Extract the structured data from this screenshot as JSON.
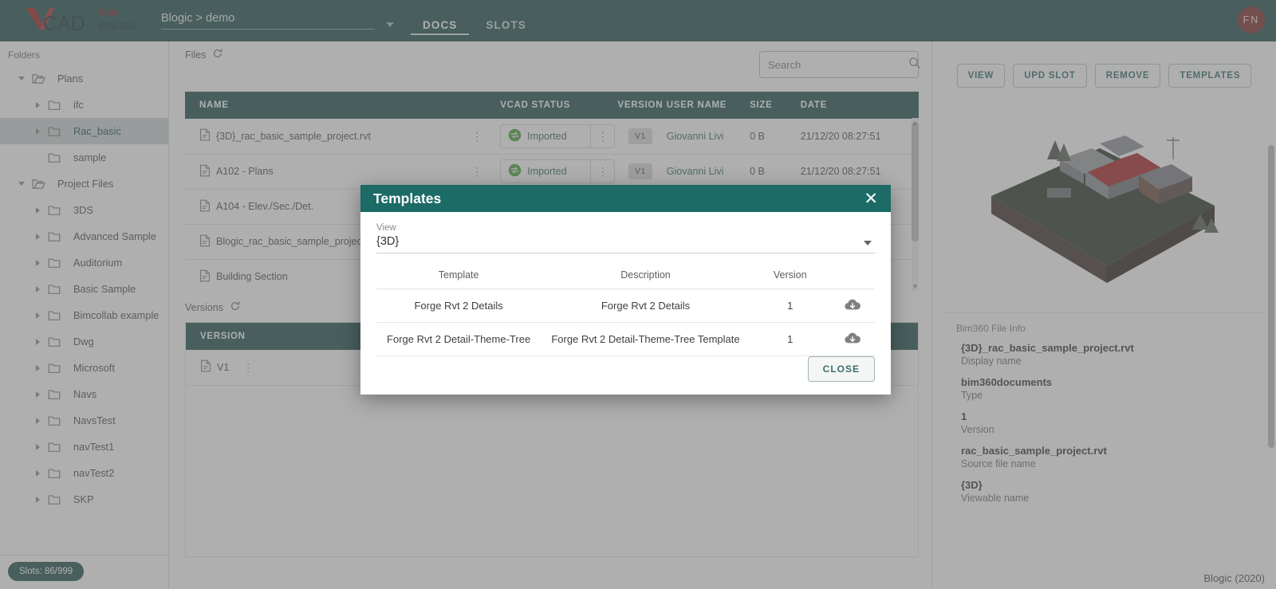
{
  "brand": {
    "logo_v": "V",
    "logo_cad": "CAD",
    "logo_for": "FOR",
    "logo_bim": "BIM360"
  },
  "topbar": {
    "project": "Blogic > demo",
    "tabs": [
      {
        "label": "DOCS",
        "active": true
      },
      {
        "label": "SLOTS",
        "active": false
      }
    ],
    "avatar_initials": "FN"
  },
  "sidebar": {
    "title": "Folders",
    "items": [
      {
        "label": "Plans",
        "level": 0,
        "expanded": true,
        "arrow": "down",
        "selected": false,
        "open_folder": true
      },
      {
        "label": "ifc",
        "level": 1,
        "expanded": false,
        "arrow": "right",
        "selected": false,
        "open_folder": false
      },
      {
        "label": "Rac_basic",
        "level": 1,
        "expanded": false,
        "arrow": "right",
        "selected": true,
        "open_folder": false
      },
      {
        "label": "sample",
        "level": 1,
        "expanded": false,
        "arrow": "none",
        "selected": false,
        "open_folder": false
      },
      {
        "label": "Project Files",
        "level": 0,
        "expanded": true,
        "arrow": "down",
        "selected": false,
        "open_folder": true
      },
      {
        "label": "3DS",
        "level": 1,
        "expanded": false,
        "arrow": "right",
        "selected": false,
        "open_folder": false
      },
      {
        "label": "Advanced Sample",
        "level": 1,
        "expanded": false,
        "arrow": "right",
        "selected": false,
        "open_folder": false
      },
      {
        "label": "Auditorium",
        "level": 1,
        "expanded": false,
        "arrow": "right",
        "selected": false,
        "open_folder": false
      },
      {
        "label": "Basic Sample",
        "level": 1,
        "expanded": false,
        "arrow": "right",
        "selected": false,
        "open_folder": false
      },
      {
        "label": "Bimcollab example",
        "level": 1,
        "expanded": false,
        "arrow": "right",
        "selected": false,
        "open_folder": false
      },
      {
        "label": "Dwg",
        "level": 1,
        "expanded": false,
        "arrow": "right",
        "selected": false,
        "open_folder": false
      },
      {
        "label": "Microsoft",
        "level": 1,
        "expanded": false,
        "arrow": "right",
        "selected": false,
        "open_folder": false
      },
      {
        "label": "Navs",
        "level": 1,
        "expanded": false,
        "arrow": "right",
        "selected": false,
        "open_folder": false
      },
      {
        "label": "NavsTest",
        "level": 1,
        "expanded": false,
        "arrow": "right",
        "selected": false,
        "open_folder": false
      },
      {
        "label": "navTest1",
        "level": 1,
        "expanded": false,
        "arrow": "right",
        "selected": false,
        "open_folder": false
      },
      {
        "label": "navTest2",
        "level": 1,
        "expanded": false,
        "arrow": "right",
        "selected": false,
        "open_folder": false
      },
      {
        "label": "SKP",
        "level": 1,
        "expanded": false,
        "arrow": "right",
        "selected": false,
        "open_folder": false
      }
    ],
    "slots_badge": "Slots: 86/999"
  },
  "files": {
    "section_label": "Files",
    "search_placeholder": "Search",
    "search_value": "",
    "columns": [
      "NAME",
      "VCAD STATUS",
      "VERSION",
      "USER NAME",
      "SIZE",
      "DATE"
    ],
    "rows": [
      {
        "name": "{3D}_rac_basic_sample_project.rvt",
        "status": "Imported",
        "version": "V1",
        "user": "Giovanni Livi",
        "size": "0 B",
        "date": "21/12/20 08:27:51"
      },
      {
        "name": "A102 - Plans",
        "status": "Imported",
        "version": "V1",
        "user": "Giovanni Livi",
        "size": "0 B",
        "date": "21/12/20 08:27:51"
      },
      {
        "name": "A104 - Elev./Sec./Det.",
        "status": "",
        "version": "",
        "user": "",
        "size": "",
        "date": ""
      },
      {
        "name": "Blogic_rac_basic_sample_project.rvt",
        "status": "",
        "version": "",
        "user": "",
        "size": "",
        "date": ""
      },
      {
        "name": "Building Section",
        "status": "",
        "version": "",
        "user": "",
        "size": "",
        "date": ""
      }
    ]
  },
  "versions": {
    "section_label": "Versions",
    "columns": [
      "VERSION"
    ],
    "rows": [
      {
        "version": "V1"
      }
    ]
  },
  "rightpanel": {
    "buttons": [
      "VIEW",
      "UPD SLOT",
      "REMOVE",
      "TEMPLATES"
    ],
    "info_title": "Bim360 File Info",
    "fields": [
      {
        "value": "{3D}_rac_basic_sample_project.rvt",
        "label": "Display name"
      },
      {
        "value": "bim360documents",
        "label": "Type"
      },
      {
        "value": "1",
        "label": "Version"
      },
      {
        "value": "rac_basic_sample_project.rvt",
        "label": "Source file name"
      },
      {
        "value": "{3D}",
        "label": "Viewable name"
      }
    ]
  },
  "footer": {
    "brand": "Blogic (2020)"
  },
  "modal": {
    "title": "Templates",
    "close_icon": "✕",
    "view_label": "View",
    "view_value": "{3D}",
    "columns": [
      "Template",
      "Description",
      "Version"
    ],
    "rows": [
      {
        "template": "Forge Rvt 2 Details",
        "description": "Forge Rvt 2 Details",
        "version": "1"
      },
      {
        "template": "Forge Rvt 2 Detail-Theme-Tree",
        "description": "Forge Rvt 2 Detail-Theme-Tree Template",
        "version": "1"
      }
    ],
    "close_button": "CLOSE"
  },
  "colors": {
    "brand_dark": "#1c4f4c",
    "modal_header": "#1c6b66",
    "accent_red": "#8b1c1c",
    "status_green": "#49a13a",
    "avatar_bg": "#7b2b2b"
  }
}
